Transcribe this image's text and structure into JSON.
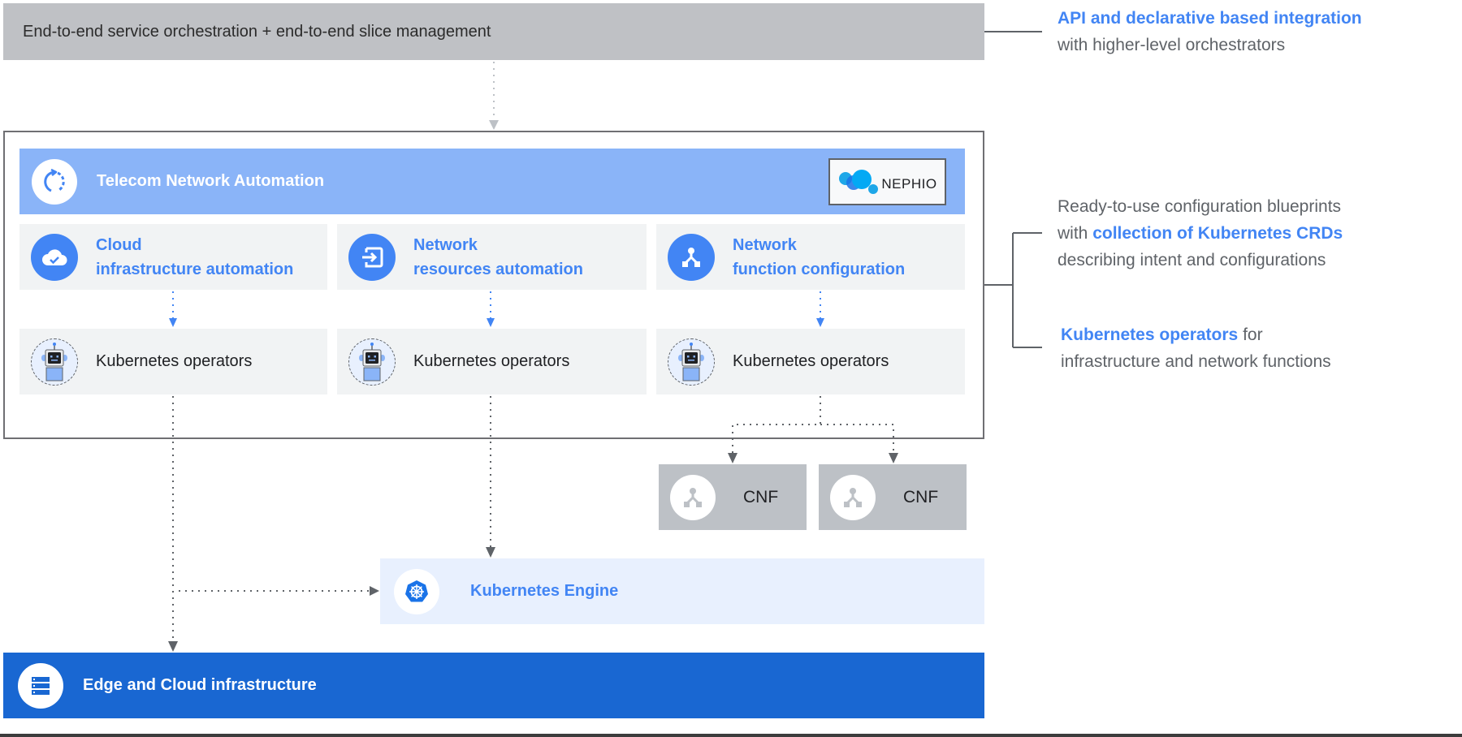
{
  "top_bar": {
    "label": "End-to-end service orchestration + end-to-end slice management"
  },
  "automation": {
    "title": "Telecom Network Automation",
    "logo_text": "NEPHIO",
    "columns": [
      {
        "line1": "Cloud",
        "line2": "infrastructure automation",
        "icon": "cloud-check-icon",
        "operator_label": "Kubernetes operators"
      },
      {
        "line1": "Network",
        "line2": "resources automation",
        "icon": "input-arrow-icon",
        "operator_label": "Kubernetes operators"
      },
      {
        "line1": "Network",
        "line2": "function configuration",
        "icon": "network-nodes-icon",
        "operator_label": "Kubernetes operators"
      }
    ]
  },
  "cnfs": [
    {
      "label": "CNF"
    },
    {
      "label": "CNF"
    }
  ],
  "kubernetes_engine": {
    "label": "Kubernetes Engine"
  },
  "edge": {
    "label": "Edge and Cloud infrastructure"
  },
  "annotations": {
    "api": {
      "highlight": "API and declarative based integration",
      "rest": "with higher-level orchestrators"
    },
    "blueprints": {
      "line1": "Ready-to-use configuration blueprints",
      "prefix": "with ",
      "highlight": "collection of Kubernetes CRDs",
      "line3": "describing intent and configurations"
    },
    "operators": {
      "highlight": "Kubernetes operators",
      "suffix": " for",
      "line2": "infrastructure and network functions"
    }
  },
  "colors": {
    "accent_blue": "#4285f4",
    "header_blue": "#8ab4f8",
    "edge_blue": "#1967d2",
    "light_blue": "#e8f0fe",
    "card_gray": "#f1f3f4",
    "cnf_gray": "#bdc1c6",
    "top_gray": "#bfc1c5"
  }
}
